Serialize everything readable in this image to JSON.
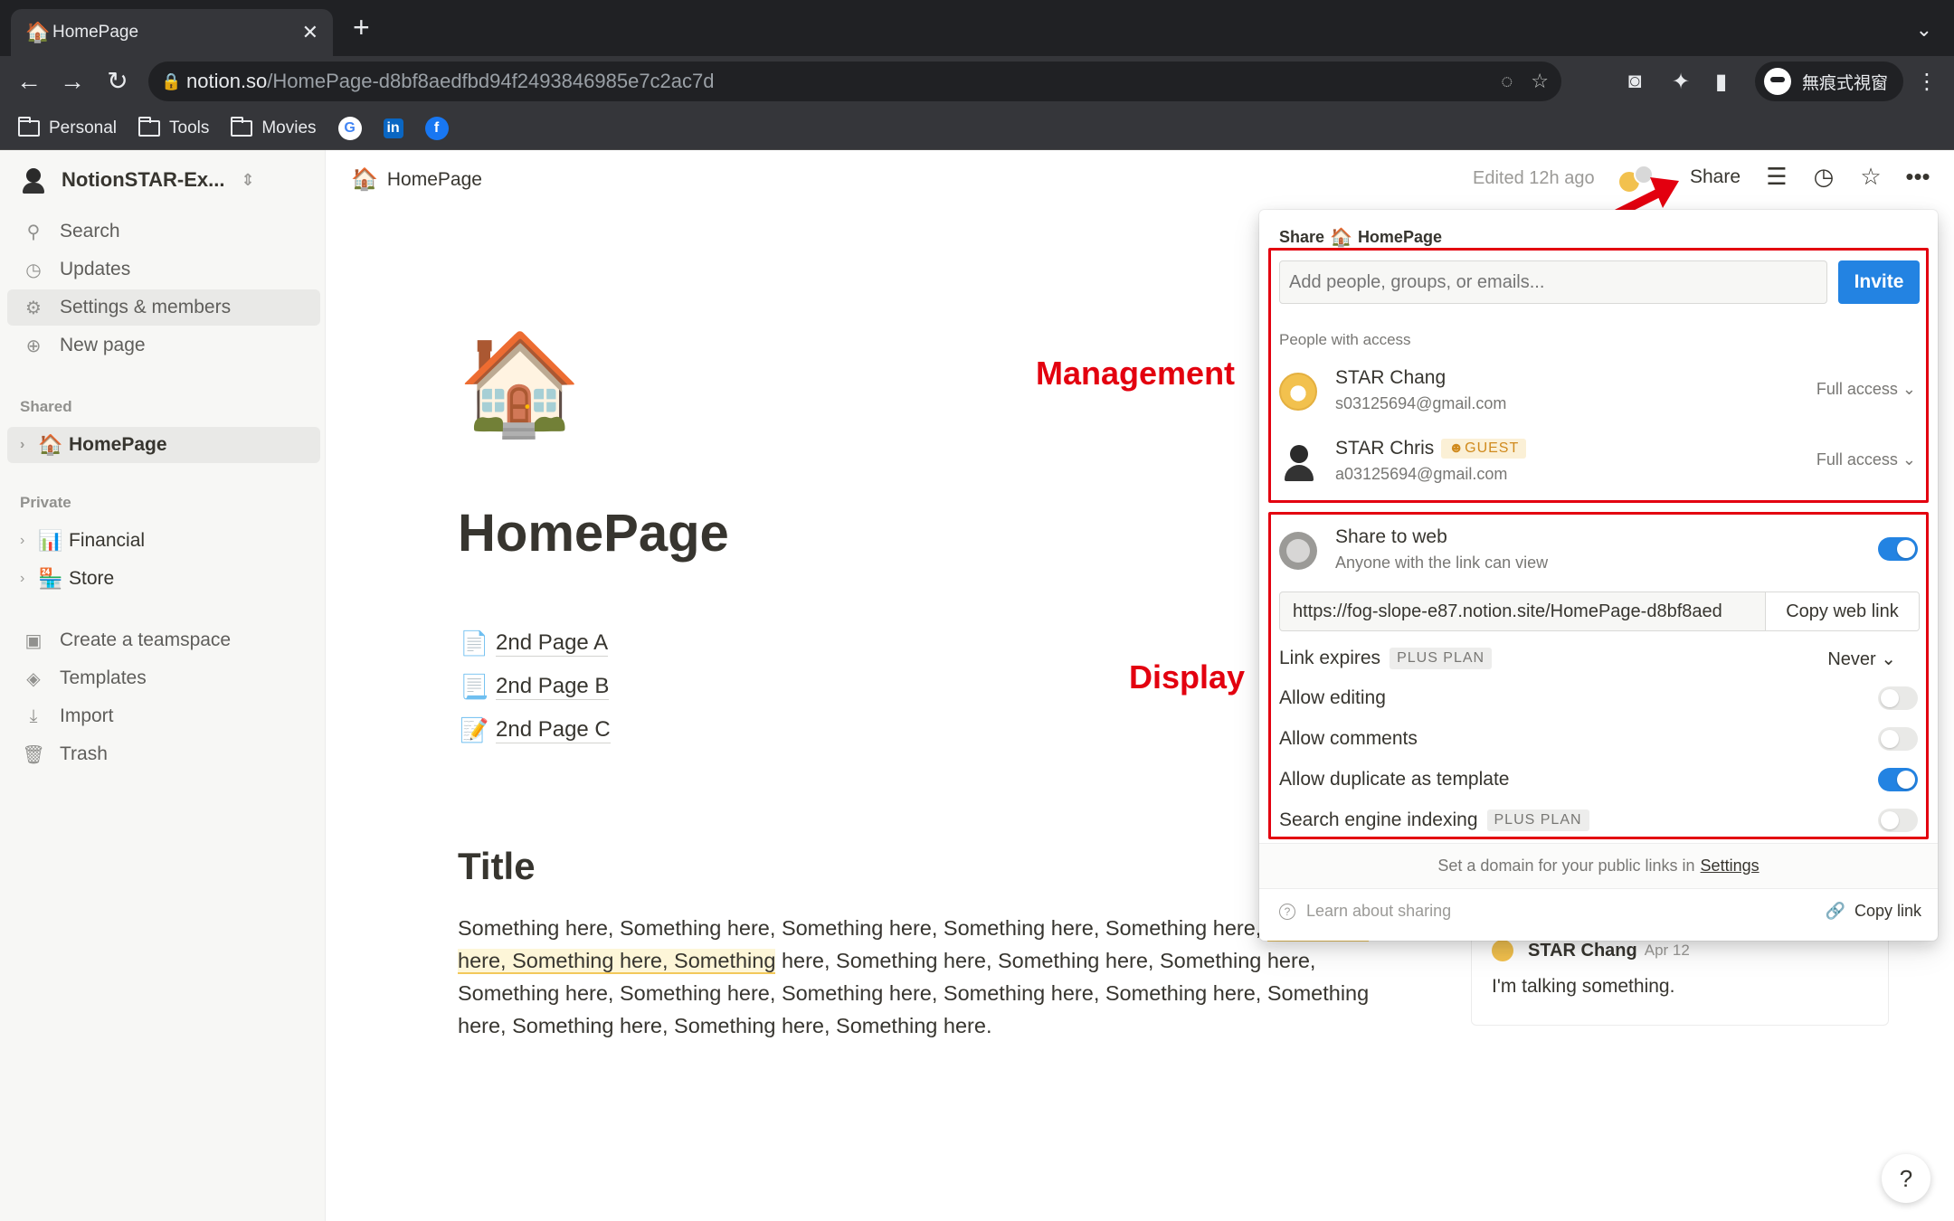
{
  "browser": {
    "tab_title": "HomePage",
    "tab_favicon": "🏠",
    "url_domain": "notion.so",
    "url_path": "/HomePage-d8bf8aedfbd94f2493846985e7c2ac7d",
    "profile_label": "無痕式視窗",
    "bookmarks": [
      "Personal",
      "Tools",
      "Movies"
    ]
  },
  "sidebar": {
    "workspace": "NotionSTAR-Ex...",
    "nav": [
      "Search",
      "Updates",
      "Settings & members",
      "New page"
    ],
    "shared_label": "Shared",
    "shared_pages": [
      {
        "emoji": "🏠",
        "label": "HomePage"
      }
    ],
    "private_label": "Private",
    "private_pages": [
      {
        "emoji": "📊",
        "label": "Financial"
      },
      {
        "emoji": "🏪",
        "label": "Store"
      }
    ],
    "bottom": [
      "Create a teamspace",
      "Templates",
      "Import",
      "Trash"
    ]
  },
  "topbar": {
    "breadcrumb_emoji": "🏠",
    "breadcrumb": "HomePage",
    "edited": "Edited 12h ago",
    "share": "Share"
  },
  "page": {
    "emoji": "🏠",
    "title": "HomePage",
    "subpages": [
      {
        "emoji": "📄",
        "label": "2nd Page A"
      },
      {
        "emoji": "📃",
        "label": "2nd Page B"
      },
      {
        "emoji": "📝",
        "label": "2nd Page C"
      }
    ],
    "heading": "Title",
    "para_start": "Something here, Something here, Something here, Something here, Something here, ",
    "para_highlight": "Something here, Something here, Something",
    "para_end": " here, Something here, Something here, Something here, Something here, Something here, Something here, Something here, Something here, Something here, Something here, Something here, Something here."
  },
  "annotations": {
    "management": "Management",
    "display": "Display"
  },
  "comment": {
    "author": "STAR Chang",
    "date": "Apr 12",
    "text": "I'm talking something."
  },
  "share_popover": {
    "header_prefix": "Share",
    "header_emoji": "🏠",
    "header_page": "HomePage",
    "invite_placeholder": "Add people, groups, or emails...",
    "invite_button": "Invite",
    "people_label": "People with access",
    "people": [
      {
        "name": "STAR Chang",
        "email": "s03125694@gmail.com",
        "access": "Full access ⌄",
        "badge": ""
      },
      {
        "name": "STAR Chris",
        "email": "a03125694@gmail.com",
        "access": "Full access ⌄",
        "badge": "☻GUEST"
      }
    ],
    "web_title": "Share to web",
    "web_subtitle": "Anyone with the link can view",
    "web_url": "https://fog-slope-e87.notion.site/HomePage-d8bf8aed",
    "copy_web_link": "Copy web link",
    "link_expires": "Link expires",
    "plus_plan": "PLUS PLAN",
    "never": "Never ⌄",
    "allow_editing": "Allow editing",
    "allow_comments": "Allow comments",
    "allow_duplicate": "Allow duplicate as template",
    "search_indexing": "Search engine indexing",
    "toggles": {
      "share_to_web": true,
      "allow_editing": false,
      "allow_comments": false,
      "allow_duplicate": true,
      "search_indexing": false
    },
    "domain_note": "Set a domain for your public links in",
    "settings_link": "Settings",
    "learn": "Learn about sharing",
    "copy_link": "Copy link"
  },
  "colors": {
    "accent": "#2383e2",
    "annotation_red": "#e3000f"
  }
}
